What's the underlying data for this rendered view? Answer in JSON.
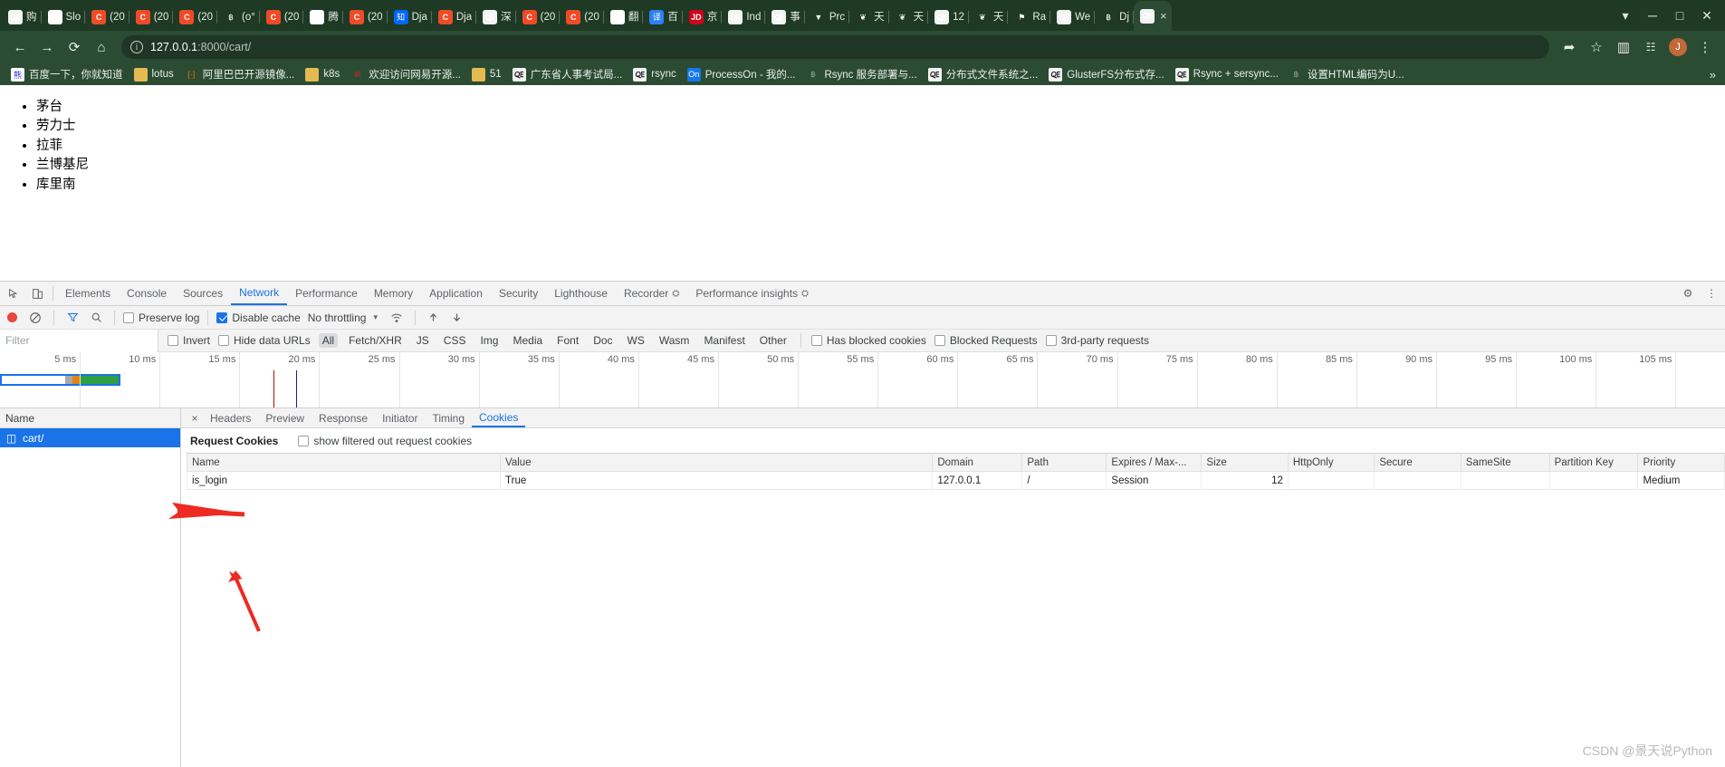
{
  "browser": {
    "tabs": [
      {
        "title": "购",
        "icon": "globe-icon",
        "icon_class": "fi-globe",
        "glyph": "🜀"
      },
      {
        "title": "Slo",
        "icon": "baidu-icon",
        "icon_class": "fi-baidu",
        "glyph": "熊"
      },
      {
        "title": "(20",
        "icon": "csdn-icon",
        "icon_class": "fi-c",
        "glyph": "C"
      },
      {
        "title": "(20",
        "icon": "csdn-icon",
        "icon_class": "fi-c",
        "glyph": "C"
      },
      {
        "title": "(20",
        "icon": "csdn-icon",
        "icon_class": "fi-c",
        "glyph": "C"
      },
      {
        "title": "(o°",
        "icon": "paw-icon",
        "icon_class": "fi-paw",
        "glyph": "฿"
      },
      {
        "title": "(20",
        "icon": "csdn-icon",
        "icon_class": "fi-c",
        "glyph": "C"
      },
      {
        "title": "腾",
        "icon": "mail-icon",
        "icon_class": "fi-m",
        "glyph": "M"
      },
      {
        "title": "(20",
        "icon": "csdn-icon",
        "icon_class": "fi-c",
        "glyph": "C"
      },
      {
        "title": "Dja",
        "icon": "zhihu-icon",
        "icon_class": "fi-zhi",
        "glyph": "知"
      },
      {
        "title": "Dja",
        "icon": "csdn-icon",
        "icon_class": "fi-c",
        "glyph": "C"
      },
      {
        "title": "深",
        "icon": "globe-icon",
        "icon_class": "fi-globe",
        "glyph": "🜀"
      },
      {
        "title": "(20",
        "icon": "csdn-icon",
        "icon_class": "fi-c",
        "glyph": "C"
      },
      {
        "title": "(20",
        "icon": "csdn-icon",
        "icon_class": "fi-c",
        "glyph": "C"
      },
      {
        "title": "翻",
        "icon": "baidu-icon",
        "icon_class": "fi-baidu",
        "glyph": "熊"
      },
      {
        "title": "百",
        "icon": "translate-icon",
        "icon_class": "fi-yi",
        "glyph": "译"
      },
      {
        "title": "京",
        "icon": "jd-icon",
        "icon_class": "fi-jd",
        "glyph": "JD"
      },
      {
        "title": "Ind",
        "icon": "globe-icon",
        "icon_class": "fi-globe",
        "glyph": "🜀"
      },
      {
        "title": "事",
        "icon": "globe-icon",
        "icon_class": "fi-globe",
        "glyph": "🜀"
      },
      {
        "title": "Prc",
        "icon": "gitlab-icon",
        "icon_class": "fi-gl",
        "glyph": "▼"
      },
      {
        "title": "天",
        "icon": "butterfly-icon",
        "icon_class": "fi-bfly",
        "glyph": "❦"
      },
      {
        "title": "天",
        "icon": "butterfly-icon",
        "icon_class": "fi-bfly",
        "glyph": "❦"
      },
      {
        "title": "12",
        "icon": "globe-icon",
        "icon_class": "fi-globe",
        "glyph": "🜀"
      },
      {
        "title": "天",
        "icon": "butterfly-icon",
        "icon_class": "fi-bfly",
        "glyph": "❦"
      },
      {
        "title": "Ra",
        "icon": "rancher-icon",
        "icon_class": "fi-rancher",
        "glyph": "⚑"
      },
      {
        "title": "We",
        "icon": "globe-icon",
        "icon_class": "fi-globe",
        "glyph": "🜀"
      },
      {
        "title": "Dj",
        "icon": "paw-icon",
        "icon_class": "fi-paw",
        "glyph": "฿"
      },
      {
        "title": "",
        "icon": "globe-icon",
        "icon_class": "fi-globe",
        "glyph": "🜀",
        "active": true,
        "close": "×"
      }
    ],
    "tabstrip_buttons": {
      "new_tab": "+",
      "tab_search": "▾",
      "minimize": "─",
      "maximize": "□",
      "close": "✕"
    },
    "toolbar": {
      "back": "←",
      "forward": "→",
      "reload": "⟳",
      "home": "⌂",
      "url_host": "127.0.0.1",
      "url_rest": ":8000/cart/",
      "site_info": "i",
      "share": "➦",
      "bookmark_star": "☆",
      "split": "▥",
      "extensions": "🧩",
      "profile": "J",
      "menu": "⋮"
    },
    "bookmarks": [
      {
        "label": "百度一下，你就知道",
        "icon": "baidu-icon",
        "icon_class": "fi-baidu",
        "glyph": "熊"
      },
      {
        "label": "lotus",
        "icon": "folder-icon",
        "icon_class": "fi-fold",
        "glyph": ""
      },
      {
        "label": "阿里巴巴开源镜像...",
        "icon": "alibaba-icon",
        "icon_class": "fi-ali",
        "glyph": "[·]"
      },
      {
        "label": "k8s",
        "icon": "folder-icon",
        "icon_class": "fi-fold",
        "glyph": ""
      },
      {
        "label": "欢迎访问网易开源...",
        "icon": "netease-icon",
        "icon_class": "fi-net",
        "glyph": "⋒"
      },
      {
        "label": "51",
        "icon": "folder-icon",
        "icon_class": "fi-fold",
        "glyph": ""
      },
      {
        "label": "广东省人事考试局...",
        "icon": "globe-icon",
        "icon_class": "fi-globe",
        "glyph": "🜀"
      },
      {
        "label": "rsync",
        "icon": "globe-icon",
        "icon_class": "fi-globe",
        "glyph": "🜀"
      },
      {
        "label": "ProcessOn - 我的...",
        "icon": "processon-icon",
        "icon_class": "fi-on",
        "glyph": "On"
      },
      {
        "label": "Rsync 服务部署与...",
        "icon": "paw-icon",
        "icon_class": "fi-paw",
        "glyph": "฿"
      },
      {
        "label": "分布式文件系统之...",
        "icon": "globe-icon",
        "icon_class": "fi-globe",
        "glyph": "🜀"
      },
      {
        "label": "GlusterFS分布式存...",
        "icon": "globe-icon",
        "icon_class": "fi-globe",
        "glyph": "🜀"
      },
      {
        "label": "Rsync + sersync...",
        "icon": "globe-icon",
        "icon_class": "fi-globe",
        "glyph": "🜀"
      },
      {
        "label": "设置HTML编码为U...",
        "icon": "paw-icon",
        "icon_class": "fi-paw",
        "glyph": "฿"
      }
    ],
    "bookmarks_overflow": "»"
  },
  "page": {
    "items": [
      "茅台",
      "劳力士",
      "拉菲",
      "兰博基尼",
      "库里南"
    ]
  },
  "devtools": {
    "panel_tabs": [
      {
        "label": "Elements"
      },
      {
        "label": "Console"
      },
      {
        "label": "Sources"
      },
      {
        "label": "Network",
        "selected": true
      },
      {
        "label": "Performance"
      },
      {
        "label": "Memory"
      },
      {
        "label": "Application"
      },
      {
        "label": "Security"
      },
      {
        "label": "Lighthouse"
      },
      {
        "label": "Recorder",
        "badge": "⛭"
      },
      {
        "label": "Performance insights",
        "badge": "⛭"
      }
    ],
    "panel_icons": {
      "inspect": "⬚",
      "device_toggle": "□",
      "settings": "⚙",
      "more": "⋮"
    },
    "network_toolbar": {
      "record": "record-button",
      "clear": "⊘",
      "filter": "▼",
      "search": "⚲",
      "preserve_log": "Preserve log",
      "preserve_log_checked": false,
      "disable_cache": "Disable cache",
      "disable_cache_checked": true,
      "throttling": "No throttling",
      "throttle_caret": "▾",
      "wifi": "◔",
      "import": "⬆",
      "export": "⬇"
    },
    "filter_bar": {
      "filter_placeholder": "Filter",
      "invert": "Invert",
      "hide_data_urls": "Hide data URLs",
      "types": [
        "All",
        "Fetch/XHR",
        "JS",
        "CSS",
        "Img",
        "Media",
        "Font",
        "Doc",
        "WS",
        "Wasm",
        "Manifest",
        "Other"
      ],
      "selected_type": "All",
      "has_blocked_cookies": "Has blocked cookies",
      "blocked_requests": "Blocked Requests",
      "third_party_requests": "3rd-party requests"
    },
    "overview": {
      "ticks": [
        "5 ms",
        "10 ms",
        "15 ms",
        "20 ms",
        "25 ms",
        "30 ms",
        "35 ms",
        "40 ms",
        "45 ms",
        "50 ms",
        "55 ms",
        "60 ms",
        "65 ms",
        "70 ms",
        "75 ms",
        "80 ms",
        "85 ms",
        "90 ms",
        "95 ms",
        "100 ms",
        "105 ms"
      ]
    },
    "requests": {
      "column_header": "Name",
      "rows": [
        {
          "name": "cart/",
          "selected": true,
          "icon": "document-icon"
        }
      ]
    },
    "detail": {
      "close": "×",
      "tabs": [
        {
          "label": "Headers"
        },
        {
          "label": "Preview"
        },
        {
          "label": "Response"
        },
        {
          "label": "Initiator"
        },
        {
          "label": "Timing"
        },
        {
          "label": "Cookies",
          "selected": true
        }
      ],
      "cookies_title": "Request Cookies",
      "show_filtered_label": "show filtered out request cookies",
      "show_filtered_checked": false,
      "table": {
        "columns": [
          "Name",
          "Value",
          "Domain",
          "Path",
          "Expires / Max-...",
          "Size",
          "HttpOnly",
          "Secure",
          "SameSite",
          "Partition Key",
          "Priority"
        ],
        "rows": [
          {
            "Name": "is_login",
            "Value": "True",
            "Domain": "127.0.0.1",
            "Path": "/",
            "Expires / Max-...": "Session",
            "Size": "12",
            "HttpOnly": "",
            "Secure": "",
            "SameSite": "",
            "Partition Key": "",
            "Priority": "Medium"
          }
        ]
      }
    }
  },
  "watermark": "CSDN @景天说Python",
  "colors": {
    "chrome_frame": "#2c4b33",
    "accent_blue": "#1a73e8",
    "record_red": "#e8453c",
    "annotation_red": "#ee2a22"
  }
}
